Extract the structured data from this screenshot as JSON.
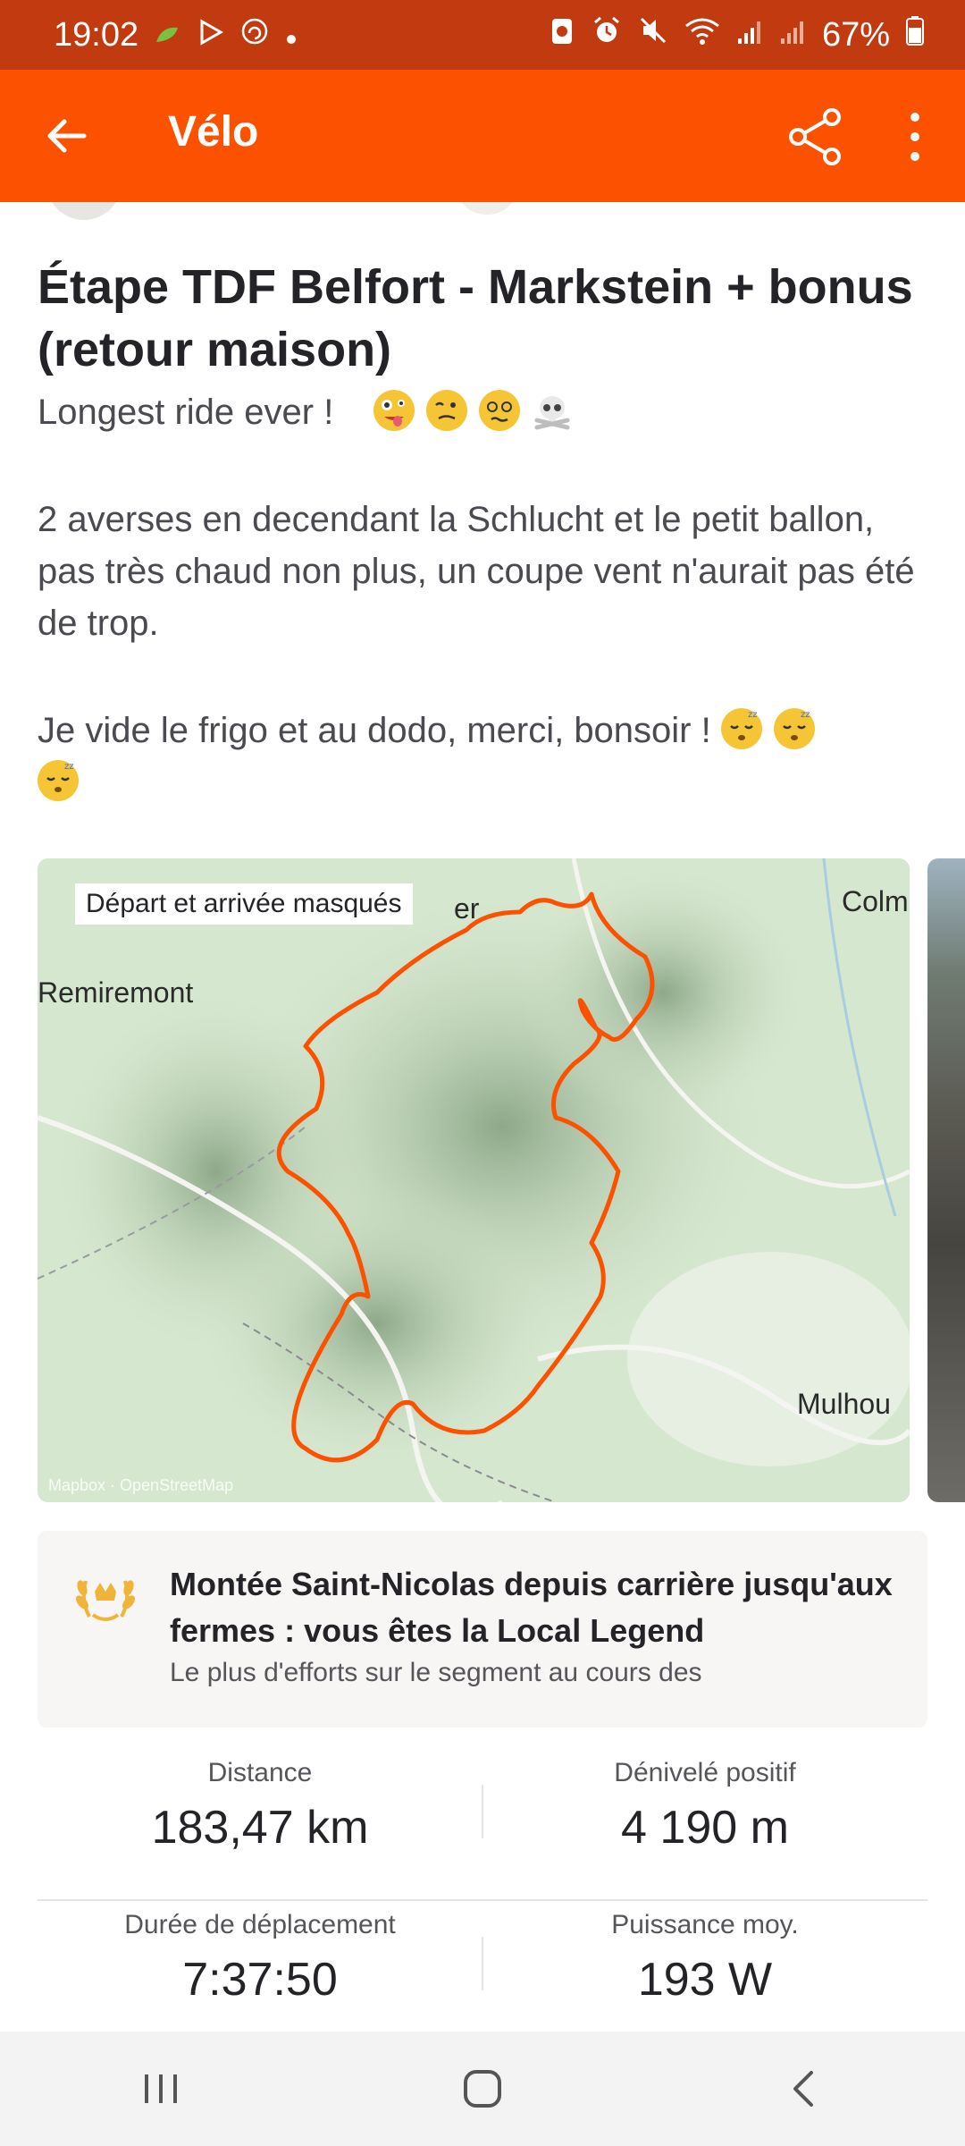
{
  "status_bar": {
    "time": "19:02",
    "battery": "67%",
    "background": "#c13a10"
  },
  "app_bar": {
    "title": "Vélo",
    "accent": "#fc5200"
  },
  "activity": {
    "title": "Étape TDF Belfort - Markstein + bonus (retour maison)",
    "description_line1": "Longest ride ever !",
    "description_para2": "2 averses en decendant la Schlucht et le petit ballon, pas très chaud non plus, un coupe vent n'aurait pas été de trop.",
    "description_para3": "Je vide le frigo et au dodo, merci, bonsoir !"
  },
  "map": {
    "badge": "Départ et arrivée masqués",
    "places": {
      "remiremont": "Remiremont",
      "colmar": "Colm",
      "mulhouse": "Mulhou",
      "top_fragment": "er"
    },
    "credit": "Mapbox · OpenStreetMap",
    "route_color": "#fc5200"
  },
  "local_legend": {
    "title": "Montée Saint-Nicolas depuis carrière jusqu'aux fermes : vous êtes la Local Legend",
    "subtitle": "Le plus d'efforts sur le segment au cours des",
    "icon": "laurel-wreath-icon"
  },
  "stats": {
    "distance_label": "Distance",
    "distance_value": "183,47 km",
    "elevation_label": "Dénivelé positif",
    "elevation_value": "4 190 m",
    "moving_time_label": "Durée de déplacement",
    "moving_time_value": "7:37:50",
    "power_label": "Puissance moy.",
    "power_value": "193 W"
  },
  "nav_bar": {
    "icons": [
      "recents-icon",
      "home-icon",
      "back-icon"
    ]
  }
}
